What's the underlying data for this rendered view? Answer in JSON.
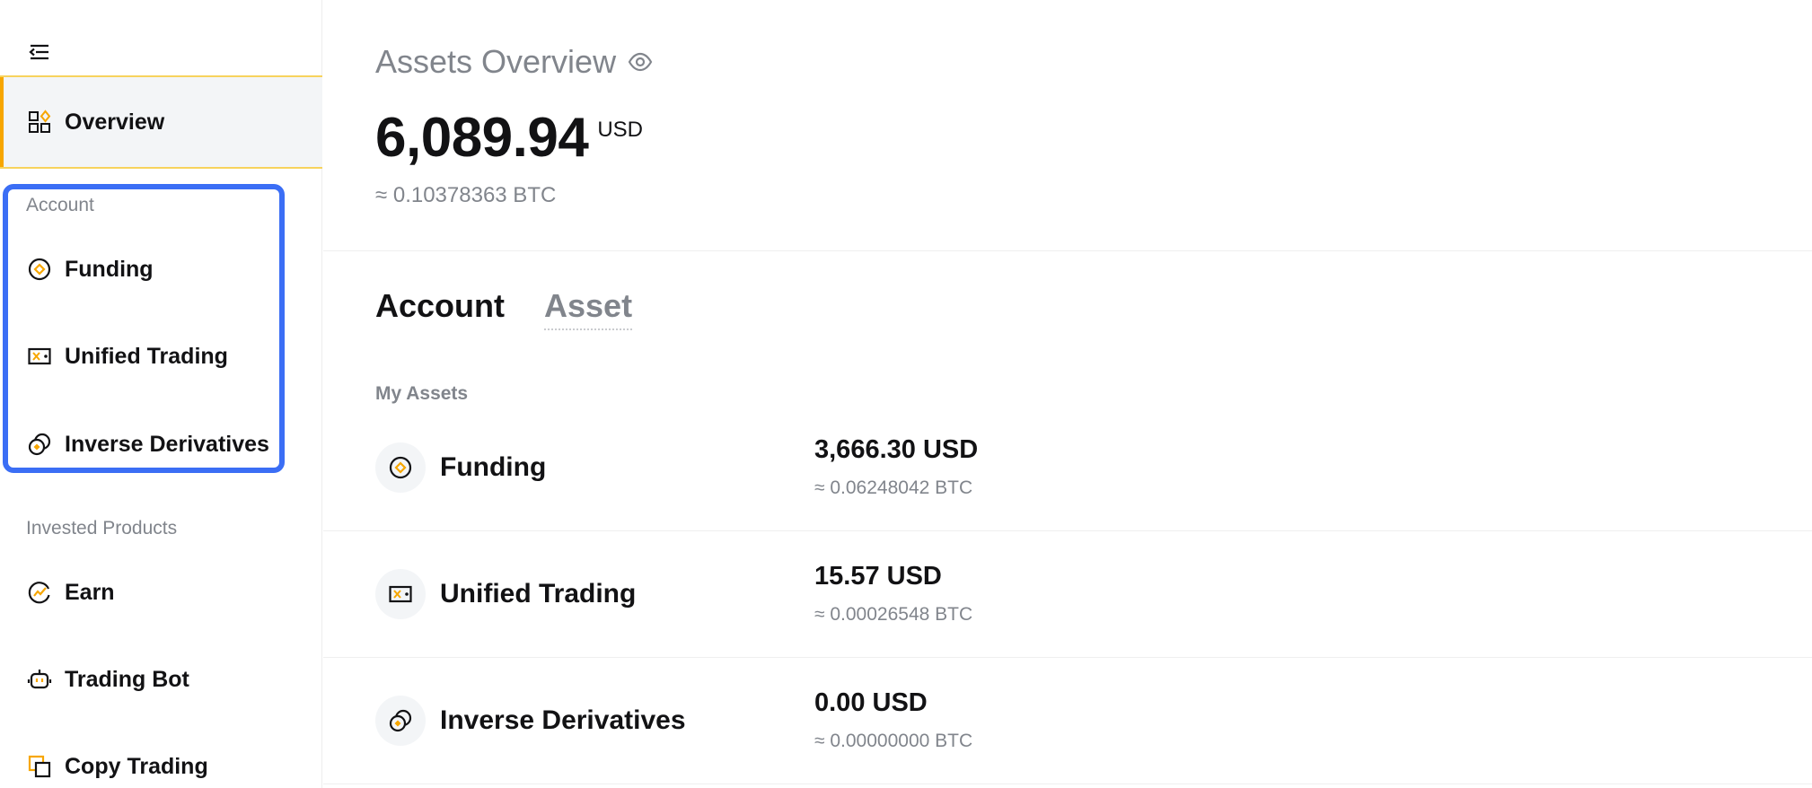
{
  "sidebar": {
    "overview_label": "Overview",
    "account_section_title": "Account",
    "account_items": [
      {
        "label": "Funding",
        "icon": "funding-icon"
      },
      {
        "label": "Unified Trading",
        "icon": "unified-trading-icon"
      },
      {
        "label": "Inverse Derivatives",
        "icon": "inverse-derivatives-icon"
      }
    ],
    "invested_section_title": "Invested Products",
    "invested_items": [
      {
        "label": "Earn",
        "icon": "earn-icon"
      },
      {
        "label": "Trading Bot",
        "icon": "trading-bot-icon"
      },
      {
        "label": "Copy Trading",
        "icon": "copy-trading-icon"
      }
    ]
  },
  "main": {
    "title": "Assets Overview",
    "total_amount": "6,089.94",
    "total_currency": "USD",
    "total_btc": "≈ 0.10378363 BTC",
    "tabs": [
      {
        "label": "Account",
        "active": true
      },
      {
        "label": "Asset",
        "active": false
      }
    ],
    "my_assets_label": "My Assets",
    "assets": [
      {
        "name": "Funding",
        "usd": "3,666.30 USD",
        "btc": "≈ 0.06248042 BTC"
      },
      {
        "name": "Unified Trading",
        "usd": "15.57 USD",
        "btc": "≈ 0.00026548 BTC"
      },
      {
        "name": "Inverse Derivatives",
        "usd": "0.00 USD",
        "btc": "≈ 0.00000000 BTC"
      }
    ]
  },
  "colors": {
    "accent": "#f7a600",
    "highlight_border": "#3b6ef5",
    "muted_text": "#81858c"
  }
}
